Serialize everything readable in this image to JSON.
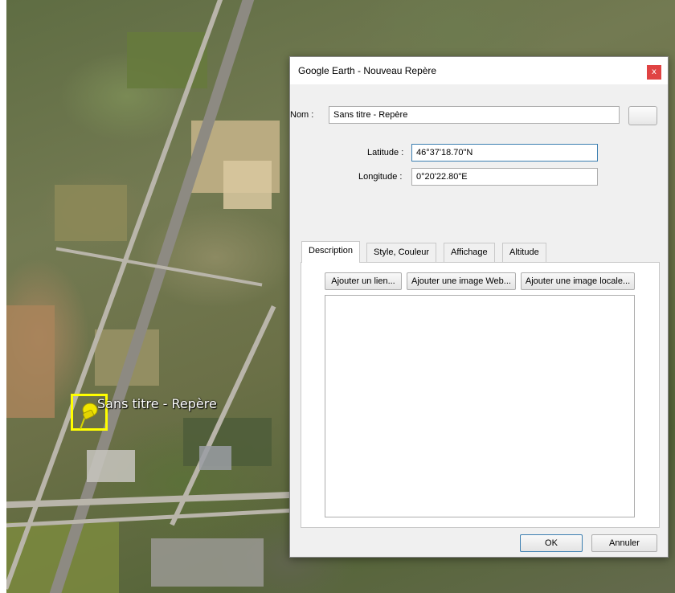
{
  "map": {
    "placemark_label": "Sans titre - Repère"
  },
  "dialog": {
    "title": "Google Earth - Nouveau Repère",
    "close_glyph": "x",
    "name_label": "Nom :",
    "name_value": "Sans titre - Repère",
    "latitude_label": "Latitude :",
    "latitude_value": "46°37'18.70\"N",
    "longitude_label": "Longitude :",
    "longitude_value": "0°20'22.80\"E",
    "tabs": [
      {
        "label": "Description",
        "active": true
      },
      {
        "label": "Style, Couleur",
        "active": false
      },
      {
        "label": "Affichage",
        "active": false
      },
      {
        "label": "Altitude",
        "active": false
      }
    ],
    "add_link": "Ajouter un lien...",
    "add_web_image": "Ajouter une image Web...",
    "add_local_image": "Ajouter une image locale...",
    "ok": "OK",
    "cancel": "Annuler"
  },
  "colors": {
    "accent": "#3c7fb1",
    "close": "#e04343",
    "placemark": "#ffff00"
  }
}
